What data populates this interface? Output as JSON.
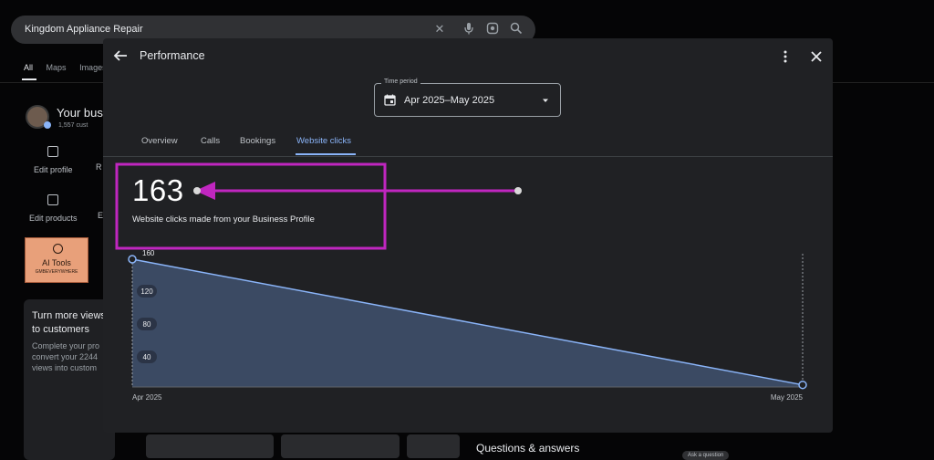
{
  "background": {
    "search_query": "Kingdom Appliance Repair",
    "tabs": [
      "All",
      "Maps",
      "Images"
    ],
    "business_name": "Your bus",
    "customers": "1,557 cust",
    "actions": [
      "Edit profile",
      "R",
      "Edit products",
      "E"
    ],
    "ai_tools": {
      "title": "AI Tools",
      "subtitle": "GMBEVERYWHERE"
    },
    "promo_title": "Turn more views to customers",
    "promo_body": "Complete your pro convert your 2244 views into custom",
    "questions_title": "Questions & answers",
    "ask_button": "Ask a question"
  },
  "modal": {
    "title": "Performance",
    "time_period": {
      "legend": "Time period",
      "value": "Apr 2025–May 2025"
    },
    "tabs": [
      {
        "label": "Overview",
        "active": false
      },
      {
        "label": "Calls",
        "active": false
      },
      {
        "label": "Bookings",
        "active": false
      },
      {
        "label": "Website clicks",
        "active": true
      }
    ],
    "stat": {
      "value": "163",
      "label": "Website clicks made from your Business Profile"
    }
  },
  "colors": {
    "accent": "#8ab4f8",
    "chart_fill": "#3b4a63",
    "chart_line": "#8ab4f8",
    "annotation": "#c026c0"
  },
  "chart_data": {
    "type": "area",
    "categories": [
      "Apr 2025",
      "May 2025"
    ],
    "series": [
      {
        "values": [
          160,
          7
        ]
      }
    ],
    "y_ticks": [
      40,
      80,
      120,
      160
    ],
    "ylim": [
      0,
      160
    ],
    "grid": false
  }
}
